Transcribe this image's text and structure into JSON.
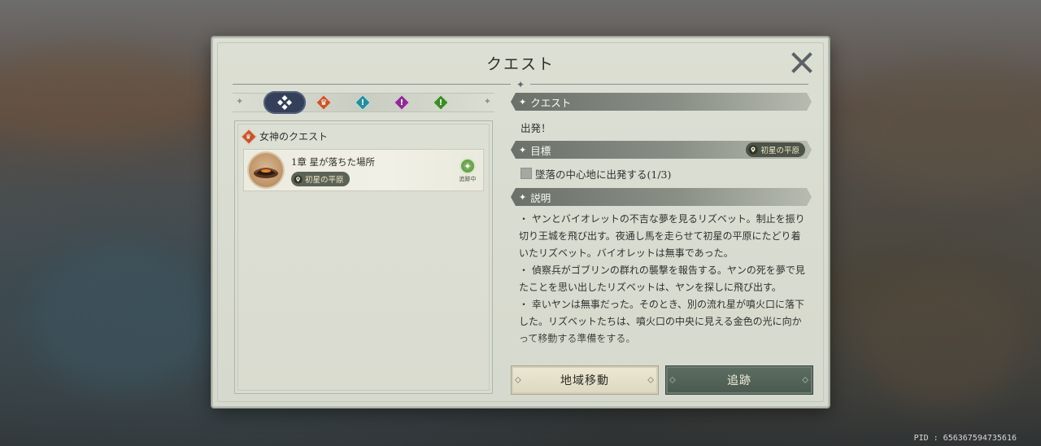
{
  "window": {
    "title": "クエスト",
    "close_icon": "close-x-icon"
  },
  "tabs": [
    {
      "id": "all",
      "icon": "four-diamonds-icon",
      "active": true,
      "color": "#34405a"
    },
    {
      "id": "goddess",
      "icon": "crown-diamond-icon",
      "active": false,
      "color": "#c4562c"
    },
    {
      "id": "teal",
      "icon": "exclamation-diamond-icon",
      "active": false,
      "color": "#2a8c9a"
    },
    {
      "id": "purple",
      "icon": "exclamation-diamond-icon",
      "active": false,
      "color": "#8a2e90"
    },
    {
      "id": "green",
      "icon": "exclamation-diamond-icon",
      "active": false,
      "color": "#3f8a2a"
    }
  ],
  "quest_list": {
    "group_title": "女神のクエスト",
    "items": [
      {
        "name": "1章 星が落ちた場所",
        "location": "初星の平原",
        "tracking_label": "追跡中"
      }
    ]
  },
  "detail": {
    "quest_section_title": "クエスト",
    "quest_name": "出発！",
    "objective_section_title": "目標",
    "objective_location": "初星の平原",
    "objective_text": "墜落の中心地に出発する(1/3)",
    "description_section_title": "説明",
    "description": "・ ヤンとバイオレットの不吉な夢を見るリズベット。制止を振り切り王城を飛び出す。夜通し馬を走らせて初星の平原にたどり着いたリズベット。バイオレットは無事であった。\n・ 偵察兵がゴブリンの群れの襲撃を報告する。ヤンの死を夢で見たことを思い出したリズベットは、ヤンを探しに飛び出す。\n・ 幸いヤンは無事だった。そのとき、別の流れ星が噴火口に落下した。リズベットたちは、噴火口の中央に見える金色の光に向かって移動する準備をする。"
  },
  "buttons": {
    "region_move": "地域移動",
    "track": "追跡"
  },
  "footer": {
    "pid": "PID : 656367594735616"
  }
}
